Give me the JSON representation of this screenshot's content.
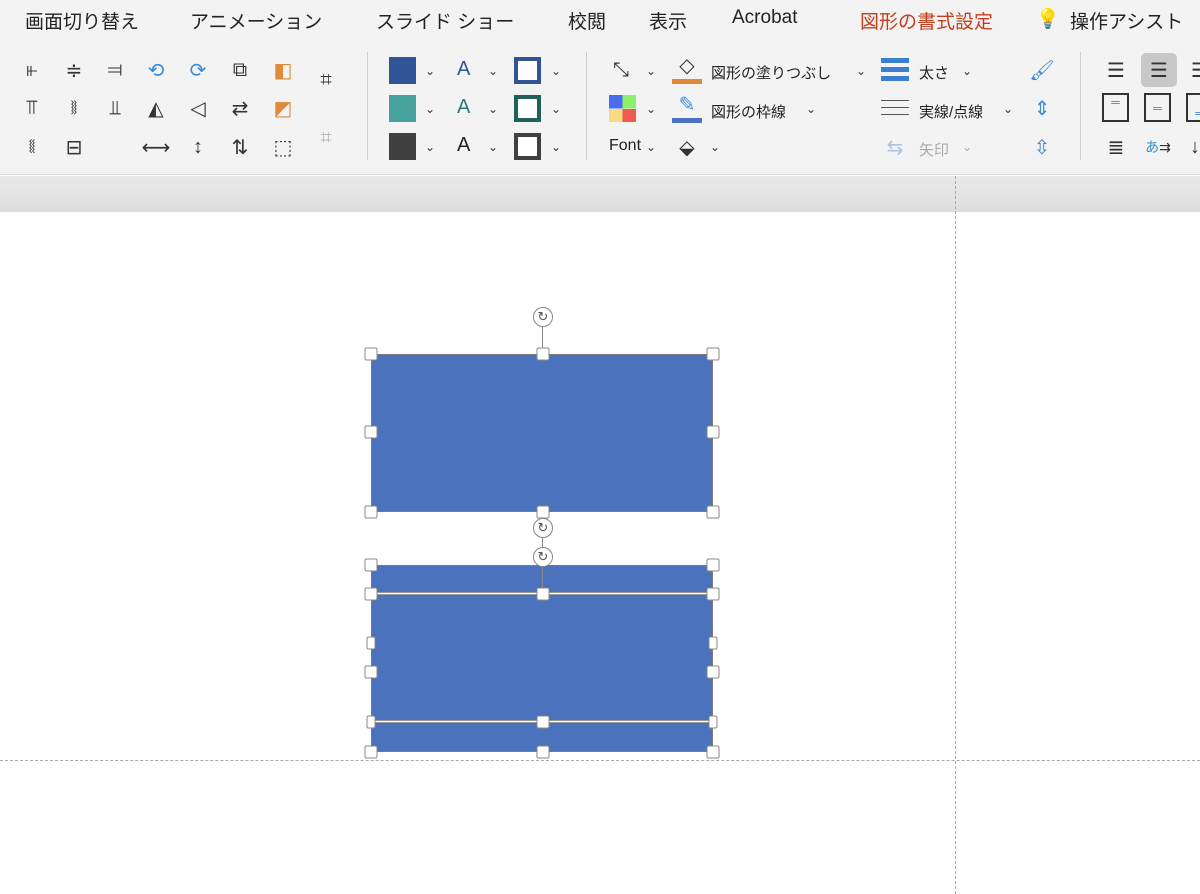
{
  "tabs": [
    {
      "label": "画面切り替え",
      "active": false
    },
    {
      "label": "アニメーション",
      "active": false
    },
    {
      "label": "スライド ショー",
      "active": false
    },
    {
      "label": "校閲",
      "active": false
    },
    {
      "label": "表示",
      "active": false
    },
    {
      "label": "Acrobat",
      "active": false
    },
    {
      "label": "図形の書式設定",
      "active": true
    },
    {
      "label": "操作アシスト",
      "active": false
    }
  ],
  "ribbon": {
    "fill_label": "図形の塗りつぶし",
    "outline_label": "図形の枠線",
    "weight_label": "太さ",
    "dash_label": "実線/点線",
    "arrow_label": "矢印",
    "font_label": "Font",
    "text_glyph": "A",
    "colors": {
      "fill_swatch": "#2f5597",
      "teal_swatch": "#46a19c",
      "dark_swatch": "#404040",
      "accent_tab": "#c43e1c",
      "shape_fill": "#4a72bd"
    }
  }
}
